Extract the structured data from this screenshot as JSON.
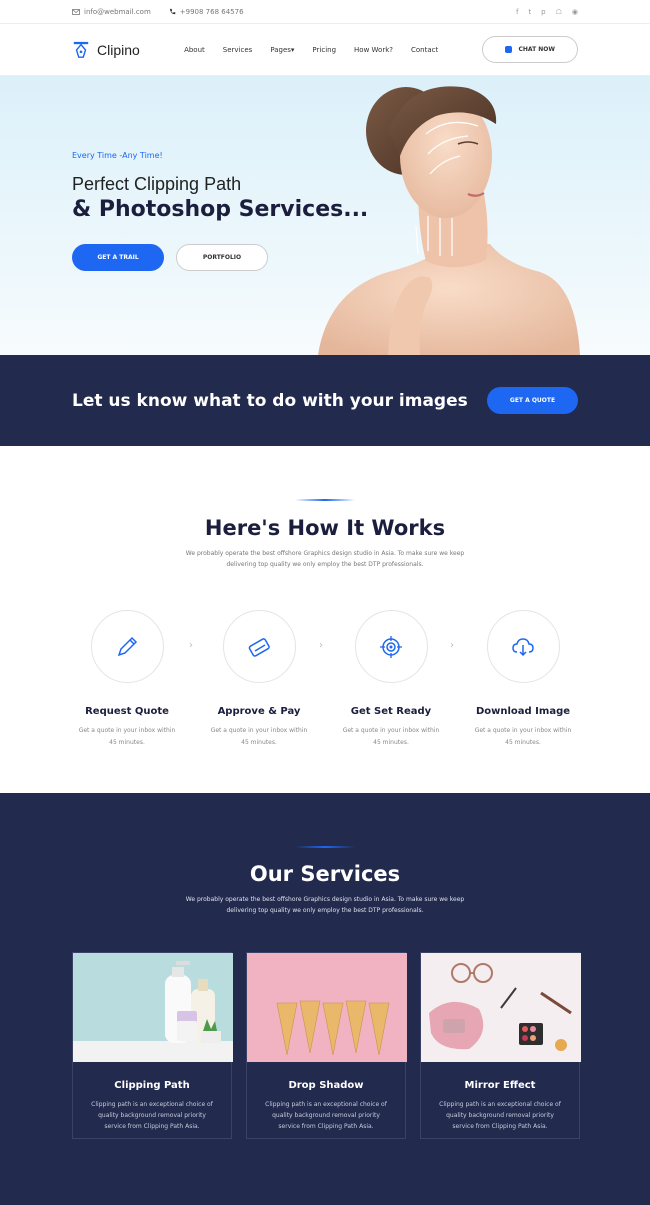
{
  "topbar": {
    "email": "info@webmail.com",
    "phone": "+9908 768 64576",
    "social_icons": [
      "facebook-icon",
      "twitter-icon",
      "pinterest-icon",
      "snapchat-icon",
      "dribbble-icon"
    ]
  },
  "nav": {
    "brand": "Clipino",
    "items": [
      "About",
      "Services",
      "Pages",
      "Pricing",
      "How Work?",
      "Contact"
    ],
    "chat_label": "CHAT NOW"
  },
  "hero": {
    "tagline": "Every Time -Any Time!",
    "title_line1": "Perfect Clipping Path",
    "title_line2": "& Photoshop Services...",
    "btn_primary": "GET A TRAIL",
    "btn_secondary": "PORTFOLIO"
  },
  "cta": {
    "text": "Let us know what to do with your images",
    "button": "GET A QUOTE"
  },
  "how": {
    "title": "Here's How It Works",
    "desc": "We probably operate the best offshore Graphics design studio in Asia. To make sure we keep delivering top quality we only employ the best DTP professionals.",
    "steps": [
      {
        "title": "Request Quote",
        "desc": "Get a quote in your inbox within 45 minutes.",
        "icon": "pencil-icon"
      },
      {
        "title": "Approve & Pay",
        "desc": "Get a quote in your inbox within 45 minutes.",
        "icon": "credit-card-icon"
      },
      {
        "title": "Get Set Ready",
        "desc": "Get a quote in your inbox within 45 minutes.",
        "icon": "target-icon"
      },
      {
        "title": "Download Image",
        "desc": "Get a quote in your inbox within 45 minutes.",
        "icon": "cloud-download-icon"
      }
    ]
  },
  "services": {
    "title": "Our Services",
    "desc": "We probably operate the best offshore Graphics design studio in Asia. To make sure we keep delivering top quality we only employ the best DTP professionals.",
    "cards": [
      {
        "title": "Clipping Path",
        "desc": "Clipping path is an exceptional choice of quality background removal priority service from Clipping Path Asia."
      },
      {
        "title": "Drop Shadow",
        "desc": "Clipping path is an exceptional choice of quality background removal priority service from Clipping Path Asia."
      },
      {
        "title": "Mirror Effect",
        "desc": "Clipping path is an exceptional choice of quality background removal priority service from Clipping Path Asia."
      }
    ]
  },
  "colors": {
    "accent": "#1d67f2",
    "navy": "#222a4d",
    "heading": "#1b1e3d"
  }
}
